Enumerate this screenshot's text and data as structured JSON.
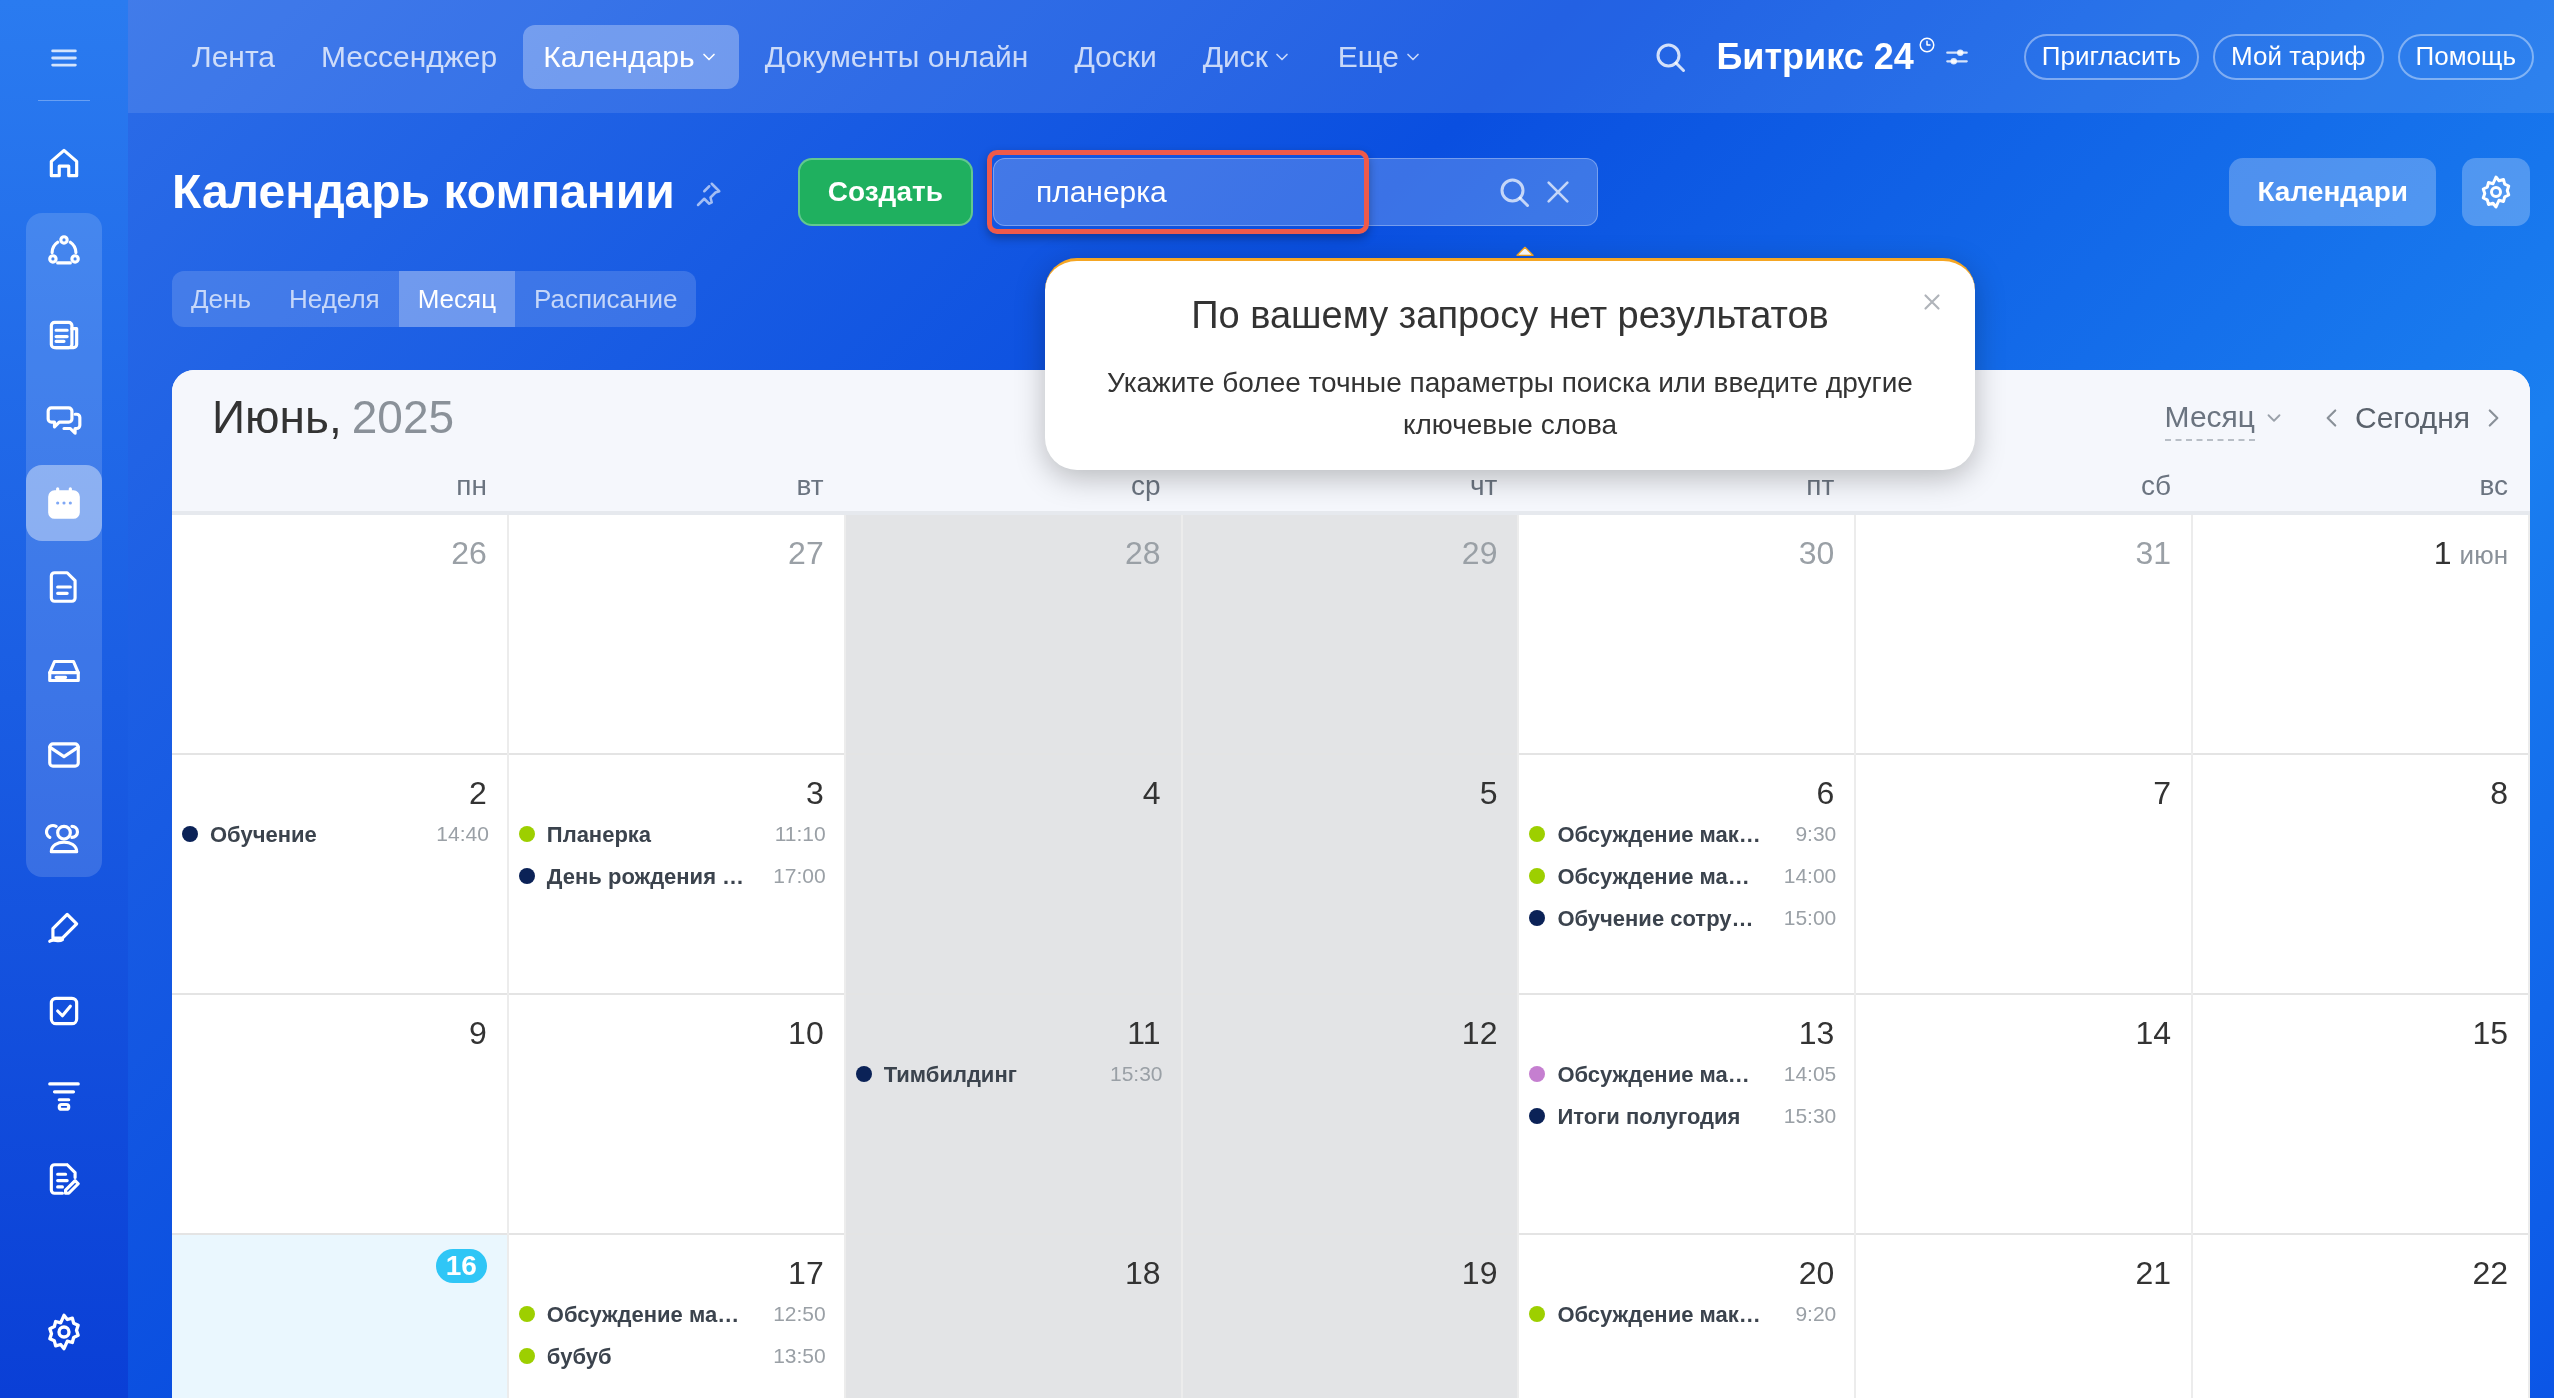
{
  "top_nav": {
    "items": [
      {
        "label": "Лента",
        "selected": false,
        "dropdown": false
      },
      {
        "label": "Мессенджер",
        "selected": false,
        "dropdown": false
      },
      {
        "label": "Календарь",
        "selected": true,
        "dropdown": true
      },
      {
        "label": "Документы онлайн",
        "selected": false,
        "dropdown": false
      },
      {
        "label": "Доски",
        "selected": false,
        "dropdown": false
      },
      {
        "label": "Диск",
        "selected": false,
        "dropdown": true
      },
      {
        "label": "Еще",
        "selected": false,
        "dropdown": true
      }
    ],
    "brand": "Битрикс 24",
    "buttons": [
      "Пригласить",
      "Мой тариф",
      "Помощь"
    ]
  },
  "sidebar": {
    "items": [
      {
        "selected": false
      },
      {
        "selected": false
      },
      {
        "selected": false
      },
      {
        "selected": false
      },
      {
        "selected": true
      },
      {
        "selected": false
      },
      {
        "selected": false
      },
      {
        "selected": false
      },
      {
        "selected": false
      },
      {
        "selected": false
      },
      {
        "selected": false
      },
      {
        "selected": false
      },
      {
        "selected": false
      }
    ]
  },
  "page": {
    "title": "Календарь компании",
    "create_button": "Создать",
    "search": {
      "value": "планерка"
    },
    "calendars_button": "Календари",
    "view_tabs": [
      {
        "label": "День",
        "selected": false
      },
      {
        "label": "Неделя",
        "selected": false
      },
      {
        "label": "Месяц",
        "selected": true
      },
      {
        "label": "Расписание",
        "selected": false
      }
    ]
  },
  "popup": {
    "title": "По вашему запросу нет результатов",
    "text": "Укажите более точные параметры поиска или введите другие ключевые слова"
  },
  "calendar": {
    "month": "Июнь,",
    "year": "2025",
    "view_select": "Месяц",
    "today_button": "Сегодня",
    "columns": [
      {
        "label": "пн",
        "shaded": false
      },
      {
        "label": "вт",
        "shaded": false
      },
      {
        "label": "ср",
        "shaded": true
      },
      {
        "label": "чт",
        "shaded": true
      },
      {
        "label": "пт",
        "shaded": false
      },
      {
        "label": "сб",
        "shaded": false
      },
      {
        "label": "вс",
        "shaded": false
      }
    ],
    "weeks": [
      [
        {
          "day": "26",
          "other_month": true,
          "today": false
        },
        {
          "day": "27",
          "other_month": true,
          "today": false
        },
        {
          "day": "28",
          "other_month": true,
          "today": false
        },
        {
          "day": "29",
          "other_month": true,
          "today": false
        },
        {
          "day": "30",
          "other_month": true,
          "today": false
        },
        {
          "day": "31",
          "other_month": true,
          "today": false
        },
        {
          "day": "1",
          "suffix": "июн",
          "other_month": false,
          "today": false
        }
      ],
      [
        {
          "day": "2",
          "other_month": false,
          "today": false,
          "events": [
            {
              "title": "Обучение",
              "time": "14:40",
              "color": "#0b2257"
            }
          ]
        },
        {
          "day": "3",
          "other_month": false,
          "today": false,
          "events": [
            {
              "title": "Планерка",
              "time": "11:10",
              "color": "#9dcf00"
            },
            {
              "title": "День рождения …",
              "time": "17:00",
              "color": "#0b2257"
            }
          ]
        },
        {
          "day": "4",
          "other_month": false,
          "today": false
        },
        {
          "day": "5",
          "other_month": false,
          "today": false
        },
        {
          "day": "6",
          "other_month": false,
          "today": false,
          "events": [
            {
              "title": "Обсуждение мак…",
              "time": "9:30",
              "color": "#9dcf00"
            },
            {
              "title": "Обсуждение ма…",
              "time": "14:00",
              "color": "#9dcf00"
            },
            {
              "title": "Обучение сотру…",
              "time": "15:00",
              "color": "#0b2257"
            }
          ]
        },
        {
          "day": "7",
          "other_month": false,
          "today": false
        },
        {
          "day": "8",
          "other_month": false,
          "today": false
        }
      ],
      [
        {
          "day": "9",
          "other_month": false,
          "today": false
        },
        {
          "day": "10",
          "other_month": false,
          "today": false
        },
        {
          "day": "11",
          "other_month": false,
          "today": false,
          "events": [
            {
              "title": "Тимбилдинг",
              "time": "15:30",
              "color": "#0b2257"
            }
          ]
        },
        {
          "day": "12",
          "other_month": false,
          "today": false
        },
        {
          "day": "13",
          "other_month": false,
          "today": false,
          "events": [
            {
              "title": "Обсуждение ма…",
              "time": "14:05",
              "color": "#c57fd0"
            },
            {
              "title": "Итоги полугодия",
              "time": "15:30",
              "color": "#0b2257"
            }
          ]
        },
        {
          "day": "14",
          "other_month": false,
          "today": false
        },
        {
          "day": "15",
          "other_month": false,
          "today": false
        }
      ],
      [
        {
          "day": "16",
          "other_month": false,
          "today": true
        },
        {
          "day": "17",
          "other_month": false,
          "today": false,
          "events": [
            {
              "title": "Обсуждение ма…",
              "time": "12:50",
              "color": "#9dcf00"
            },
            {
              "title": "бубуб",
              "time": "13:50",
              "color": "#9dcf00"
            }
          ]
        },
        {
          "day": "18",
          "other_month": false,
          "today": false
        },
        {
          "day": "19",
          "other_month": false,
          "today": false
        },
        {
          "day": "20",
          "other_month": false,
          "today": false,
          "events": [
            {
              "title": "Обсуждение мак…",
              "time": "9:20",
              "color": "#9dcf00"
            }
          ]
        },
        {
          "day": "21",
          "other_month": false,
          "today": false
        },
        {
          "day": "22",
          "other_month": false,
          "today": false
        }
      ]
    ]
  }
}
